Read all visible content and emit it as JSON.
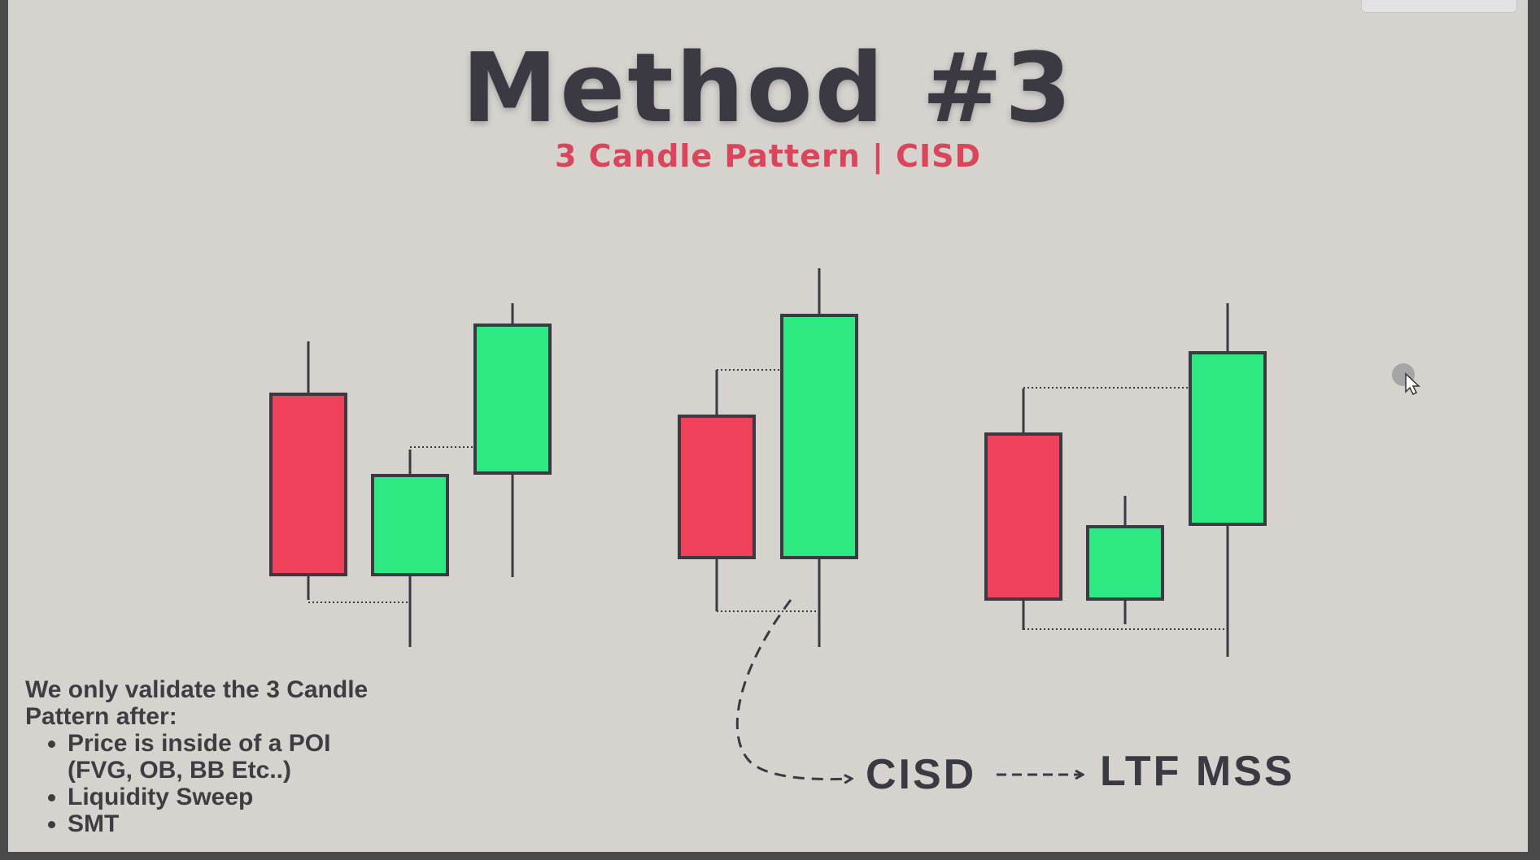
{
  "slide": {
    "title": "Method #3",
    "subtitle": "3 Candle Pattern | CISD"
  },
  "colors": {
    "bearish": "#ef4159",
    "bullish": "#2ee881",
    "outline": "#3b3a42",
    "title": "#3b3a42",
    "subtitle": "#d9455b",
    "background": "#d6d3cf"
  },
  "diagram": {
    "label_cisd": "CISD",
    "label_ltf_mss": "LTF MSS"
  },
  "notes": {
    "intro": "We only validate the 3 Candle Pattern after:",
    "conditions": [
      "Price is inside of a POI (FVG, OB, BB Etc..)",
      "Liquidity Sweep",
      "SMT"
    ]
  }
}
